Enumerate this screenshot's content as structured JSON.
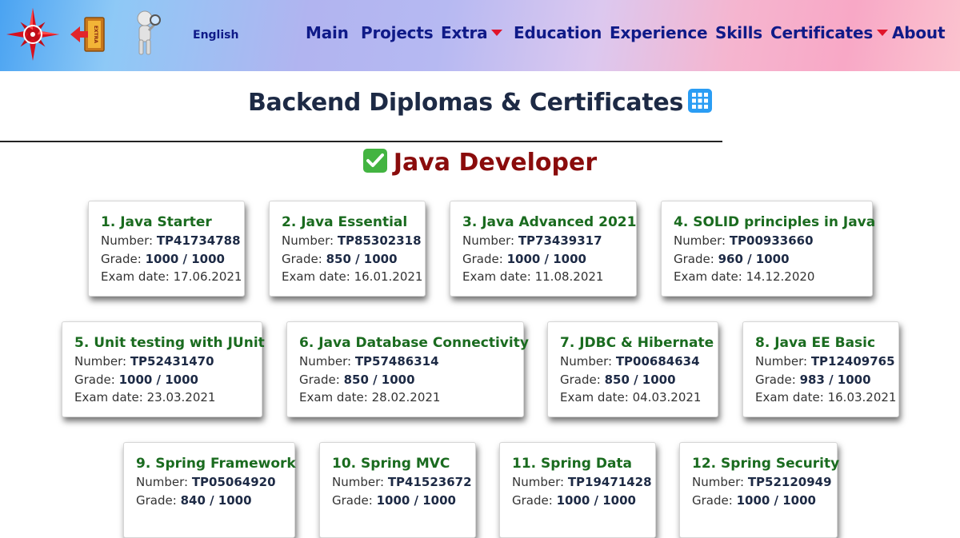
{
  "header": {
    "language": "English",
    "nav": [
      {
        "label": "Main",
        "dropdown": false
      },
      {
        "label": "Projects",
        "dropdown": false
      },
      {
        "label": "Extra",
        "dropdown": true
      },
      {
        "label": "Education",
        "dropdown": false
      },
      {
        "label": "Experience",
        "dropdown": false
      },
      {
        "label": "Skills",
        "dropdown": false
      },
      {
        "label": "Certificates",
        "dropdown": true
      },
      {
        "label": "About",
        "dropdown": false
      }
    ],
    "extra_badge": "EXTRA",
    "icons": {
      "logo": "compass-rose-icon",
      "exit": "extra-exit-icon",
      "search": "search-man-icon"
    }
  },
  "main": {
    "page_title": "Backend Diplomas & Certificates",
    "section_title": "Java Developer",
    "labels": {
      "number": "Number:",
      "grade": "Grade:",
      "exam_date": "Exam date:"
    },
    "certificates": [
      {
        "title": "1. Java Starter",
        "number": "TP41734788",
        "grade": "1000 / 1000",
        "exam_date": "17.06.2021"
      },
      {
        "title": "2. Java Essential",
        "number": "TP85302318",
        "grade": "850 / 1000",
        "exam_date": "16.01.2021"
      },
      {
        "title": "3. Java Advanced 2021",
        "number": "TP73439317",
        "grade": "1000 / 1000",
        "exam_date": "11.08.2021"
      },
      {
        "title": "4. SOLID principles in Java",
        "number": "TP00933660",
        "grade": "960 / 1000",
        "exam_date": "14.12.2020"
      },
      {
        "title": "5. Unit testing with JUnit",
        "number": "TP52431470",
        "grade": "1000 / 1000",
        "exam_date": "23.03.2021"
      },
      {
        "title": "6. Java Database Connectivity",
        "number": "TP57486314",
        "grade": "850 / 1000",
        "exam_date": "28.02.2021"
      },
      {
        "title": "7. JDBC & Hibernate",
        "number": "TP00684634",
        "grade": "850 / 1000",
        "exam_date": "04.03.2021"
      },
      {
        "title": "8. Java EE Basic",
        "number": "TP12409765",
        "grade": "983 / 1000",
        "exam_date": "16.03.2021"
      },
      {
        "title": "9. Spring Framework",
        "number": "TP05064920",
        "grade": "840 / 1000",
        "exam_date": ""
      },
      {
        "title": "10. Spring MVC",
        "number": "TP41523672",
        "grade": "1000 / 1000",
        "exam_date": ""
      },
      {
        "title": "11. Spring Data",
        "number": "TP19471428",
        "grade": "1000 / 1000",
        "exam_date": ""
      },
      {
        "title": "12. Spring Security",
        "number": "TP52120949",
        "grade": "1000 / 1000",
        "exam_date": ""
      }
    ]
  },
  "colors": {
    "nav_text": "#0f1a88",
    "card_title": "#1a6b1f",
    "section_title": "#8a0c0c",
    "page_title": "#1d2a45",
    "caret": "#e0142a"
  }
}
